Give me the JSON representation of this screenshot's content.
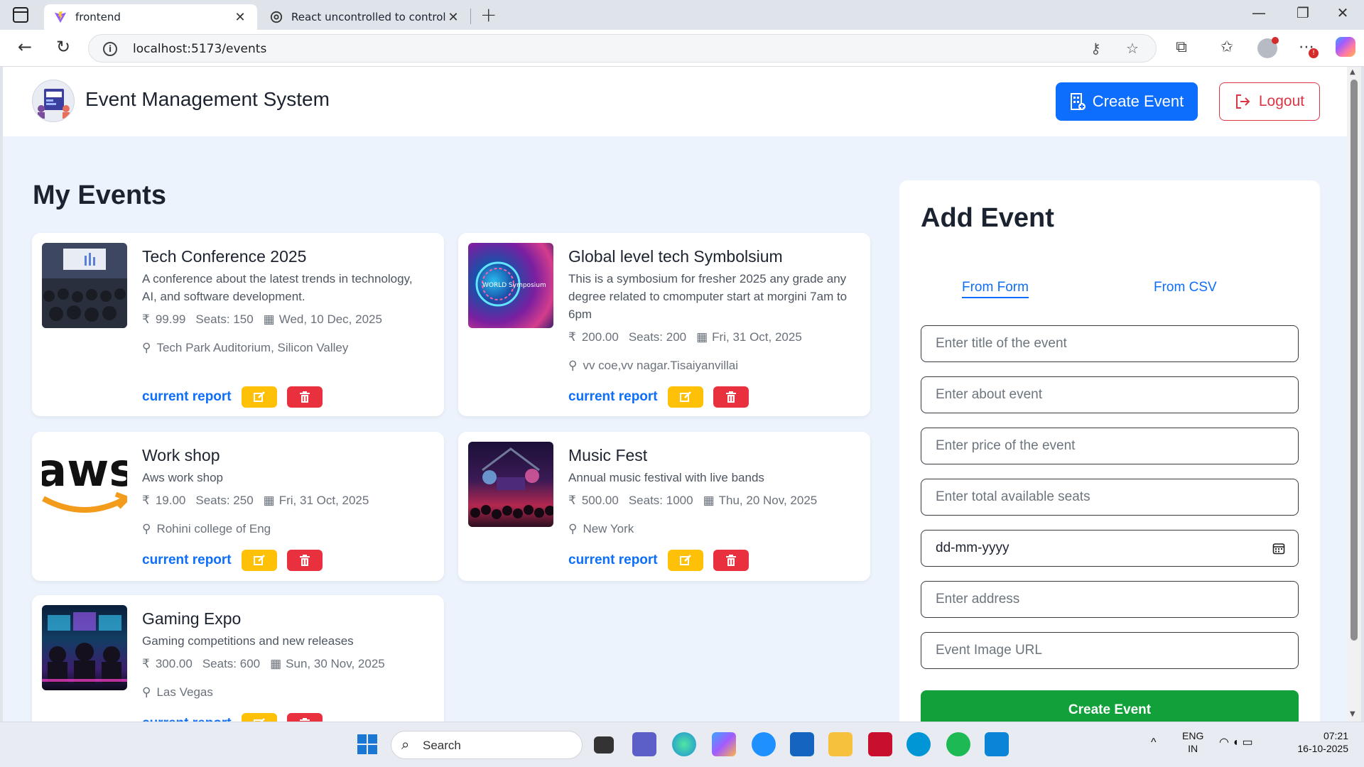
{
  "browser": {
    "tabs": [
      {
        "title": "frontend",
        "active": true
      },
      {
        "title": "React uncontrolled to controlled",
        "active": false
      }
    ],
    "url": "localhost:5173/events"
  },
  "header": {
    "brand": "Event Management System",
    "create_button": "Create Event",
    "logout_button": "Logout"
  },
  "main": {
    "title": "My Events",
    "events": [
      {
        "title": "Tech Conference 2025",
        "description": "A conference about the latest trends in technology, AI, and software development.",
        "price": "99.99",
        "seats": "Seats: 150",
        "date": "Wed, 10 Dec, 2025",
        "location": "Tech Park Auditorium, Silicon Valley",
        "report": "current report"
      },
      {
        "title": "Global level tech Symbolsium",
        "description": "This is a symbosium for fresher 2025 any grade any degree related to cmomputer start at morgini 7am to 6pm",
        "price": "200.00",
        "seats": "Seats: 200",
        "date": "Fri, 31 Oct, 2025",
        "location": "vv coe,vv nagar.Tisaiyanvillai",
        "report": "current report"
      },
      {
        "title": "Work shop",
        "description": "Aws work shop",
        "price": "19.00",
        "seats": "Seats: 250",
        "date": "Fri, 31 Oct, 2025",
        "location": "Rohini college of Eng",
        "report": "current report"
      },
      {
        "title": "Music Fest",
        "description": "Annual music festival with live bands",
        "price": "500.00",
        "seats": "Seats: 1000",
        "date": "Thu, 20 Nov, 2025",
        "location": "New York",
        "report": "current report"
      },
      {
        "title": "Gaming Expo",
        "description": "Gaming competitions and new releases",
        "price": "300.00",
        "seats": "Seats: 600",
        "date": "Sun, 30 Nov, 2025",
        "location": "Las Vegas",
        "report": "current report"
      }
    ],
    "thumb_labels": {
      "symposium": "WORLD Symposium",
      "aws": "aws"
    }
  },
  "form": {
    "title": "Add Event",
    "tabs": [
      "From Form",
      "From CSV"
    ],
    "placeholders": {
      "title": "Enter title of the event",
      "about": "Enter about event",
      "price": "Enter price of the event",
      "seats": "Enter total available seats",
      "date": "dd-mm-yyyy",
      "address": "Enter address",
      "image": "Event Image URL"
    },
    "submit": "Create Event"
  },
  "taskbar": {
    "search": "Search",
    "lang_top": "ENG",
    "lang_bottom": "IN",
    "time": "07:21",
    "date": "16-10-2025"
  },
  "icons": {
    "rupee": "₹",
    "colors": {
      "primary": "#0d6efd",
      "danger": "#dc3545",
      "warning": "#ffc107",
      "success": "#12a03a",
      "page_bg": "#edf3fc"
    }
  }
}
